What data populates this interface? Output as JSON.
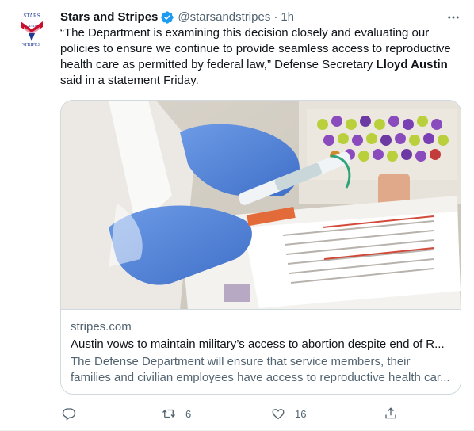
{
  "tweet": {
    "author": {
      "display_name": "Stars and Stripes",
      "handle": "@starsandstripes",
      "separator": "·",
      "timestamp": "1h",
      "verified": true,
      "avatar_text_top": "STARS",
      "avatar_text_mid": "AND",
      "avatar_text_bottom": "STRIPES."
    },
    "text_part1": "“The Department is examining this decision closely and evaluating our policies to ensure we continue to provide seamless access to reproductive health care as permitted by federal law,” Defense Secretary ",
    "text_bold": "Lloyd Austin",
    "text_part2": " said in a statement Friday.",
    "card": {
      "image_icon": "blood-draw-photo",
      "domain": "stripes.com",
      "title": "Austin vows to maintain military’s access to abortion despite end of R...",
      "description": "The Defense Department will ensure that service members, their families and civilian employees have access to reproductive health car..."
    },
    "actions": {
      "reply_count": "",
      "retweet_count": "6",
      "like_count": "16"
    },
    "icons": {
      "reply": "reply-icon",
      "retweet": "retweet-icon",
      "like": "heart-icon",
      "share": "share-icon",
      "more": "more-icon",
      "verified": "verified-badge-icon"
    },
    "colors": {
      "verified_blue": "#1d9bf0",
      "secondary_text": "#536471",
      "avatar_red": "#c8102e",
      "avatar_blue": "#1f3a93"
    }
  }
}
